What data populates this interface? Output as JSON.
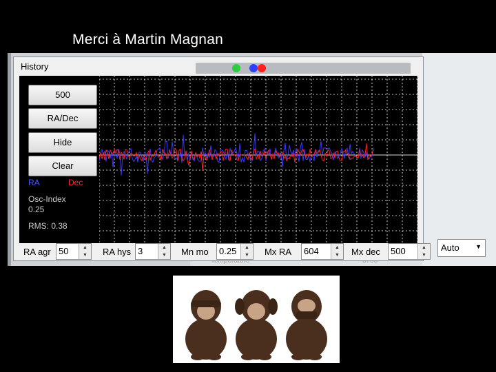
{
  "slide": {
    "title": "Merci à Martin Magnan"
  },
  "window": {
    "title": "History",
    "background_text": {
      "left": "Temperature",
      "right": "3700"
    }
  },
  "controls": {
    "buttons": [
      "500",
      "RA/Dec",
      "Hide",
      "Clear"
    ],
    "legend_ra": "RA",
    "legend_dec": "Dec",
    "osc_label": "Osc-Index",
    "osc_value": "0.25",
    "rms": "RMS: 0.38"
  },
  "bottom_bar": {
    "fields": [
      {
        "label": "RA agr",
        "value": "50"
      },
      {
        "label": "RA hys",
        "value": "3"
      },
      {
        "label": "Mn mo",
        "value": "0.25"
      },
      {
        "label": "Mx RA",
        "value": "604"
      },
      {
        "label": "Mx dec",
        "value": "500"
      }
    ],
    "mode": "Auto"
  },
  "colors": {
    "ra": "#3a3aff",
    "dec": "#ff2020",
    "grid": "#ffffff",
    "plot_bg": "#000000"
  },
  "icons": {
    "spinner_up": "▲",
    "spinner_down": "▼",
    "dropdown": "▼"
  }
}
